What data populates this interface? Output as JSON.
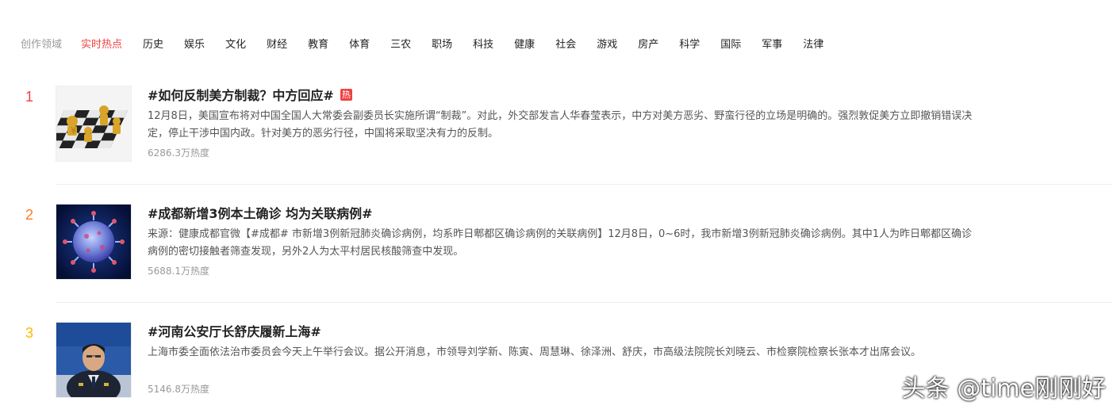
{
  "nav": {
    "label": "创作领域",
    "items": [
      "实时热点",
      "历史",
      "娱乐",
      "文化",
      "财经",
      "教育",
      "体育",
      "三农",
      "职场",
      "科技",
      "健康",
      "社会",
      "游戏",
      "房产",
      "科学",
      "国际",
      "军事",
      "法律"
    ],
    "active_color": "#f04142"
  },
  "list": [
    {
      "rank": "1",
      "rank_color": "#f04142",
      "title": "#如何反制美方制裁？中方回应#",
      "badge": "热",
      "desc": "12月8日，美国宣布将对中国全国人大常委会副委员长实施所谓“制裁”。对此，外交部发言人华春莹表示，中方对美方恶劣、野蛮行径的立场是明确的。强烈敦促美方立即撤销错误决定，停止干涉中国内政。针对美方的恶劣行径，中国将采取坚决有力的反制。",
      "heat": "6286.3万热度",
      "thumb_icon": "chess-board-thumbnail"
    },
    {
      "rank": "2",
      "rank_color": "#ff7a22",
      "title": "#成都新增3例本土确诊 均为关联病例#",
      "desc": "来源：健康成都官微【#成都# 市新增3例新冠肺炎确诊病例，均系昨日郫都区确诊病例的关联病例】12月8日，0~6时，我市新增3例新冠肺炎确诊病例。其中1人为昨日郫都区确诊病例的密切接触者筛查发现，另外2人为太平村居民核酸筛查中发现。",
      "heat": "5688.1万热度",
      "thumb_icon": "virus-thumbnail"
    },
    {
      "rank": "3",
      "rank_color": "#ffb800",
      "title": "#河南公安厅长舒庆履新上海#",
      "desc": "上海市委全面依法治市委员会今天上午举行会议。据公开消息，市领导刘学新、陈寅、周慧琳、徐泽洲、舒庆，市高级法院院长刘晓云、市检察院检察长张本才出席会议。",
      "heat": "5146.8万热度",
      "thumb_icon": "official-portrait-thumbnail"
    }
  ],
  "watermark": "头条 @time刚刚好"
}
